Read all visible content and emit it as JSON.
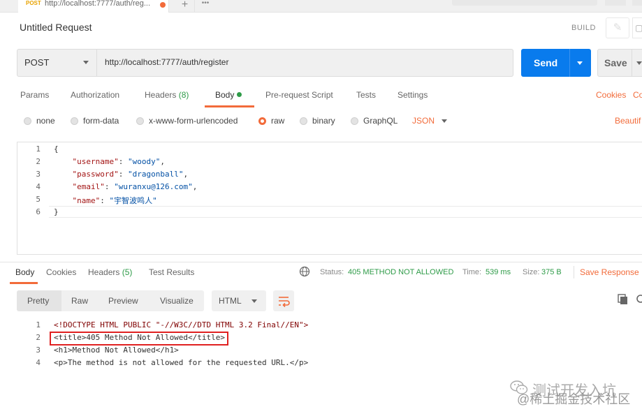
{
  "tab": {
    "method": "POST",
    "url": "http://localhost:7777/auth/reg..."
  },
  "header": {
    "title": "Untitled Request",
    "build": "BUILD"
  },
  "request": {
    "method": "POST",
    "url": "http://localhost:7777/auth/register",
    "send": "Send",
    "save": "Save"
  },
  "req_tabs": {
    "params": "Params",
    "authorization": "Authorization",
    "headers": "Headers",
    "headers_count": "(8)",
    "body": "Body",
    "prerequest": "Pre-request Script",
    "tests": "Tests",
    "settings": "Settings",
    "cookies": "Cookies",
    "code": "Co"
  },
  "body_types": {
    "none": "none",
    "form_data": "form-data",
    "urlencoded": "x-www-form-urlencoded",
    "raw": "raw",
    "binary": "binary",
    "graphql": "GraphQL",
    "format": "JSON",
    "beautify": "Beautif"
  },
  "editor": {
    "line_numbers": [
      "1",
      "2",
      "3",
      "4",
      "5",
      "6"
    ],
    "open": "{",
    "close": "}",
    "fields": [
      {
        "key": "\"username\"",
        "value": "\"woody\"",
        "comma": ","
      },
      {
        "key": "\"password\"",
        "value": "\"dragonball\"",
        "comma": ","
      },
      {
        "key": "\"email\"",
        "value": "\"wuranxu@126.com\"",
        "comma": ","
      },
      {
        "key": "\"name\"",
        "value": "\"宇智波鸣人\"",
        "comma": ""
      }
    ]
  },
  "response": {
    "tabs": {
      "body": "Body",
      "cookies": "Cookies",
      "headers": "Headers",
      "headers_count": "(5)",
      "test_results": "Test Results"
    },
    "status_label": "Status:",
    "status_value": "405 METHOD NOT ALLOWED",
    "time_label": "Time:",
    "time_value": "539 ms",
    "size_label": "Size:",
    "size_value": "375 B",
    "save_response": "Save Response",
    "views": {
      "pretty": "Pretty",
      "raw": "Raw",
      "preview": "Preview",
      "visualize": "Visualize"
    },
    "format": "HTML",
    "line_numbers": [
      "1",
      "2",
      "3",
      "4"
    ],
    "lines": [
      "<!DOCTYPE HTML PUBLIC \"-//W3C//DTD HTML 3.2 Final//EN\">",
      "<title>405 Method Not Allowed</title>",
      "<h1>Method Not Allowed</h1>",
      "<p>The method is not allowed for the requested URL.</p>"
    ]
  },
  "watermark": {
    "line1": "测试开发入坑",
    "line2": "@稀土掘金技术社区"
  },
  "colors": {
    "accent": "#f26b3a",
    "send": "#097bed",
    "status_ok": "#2e9b48",
    "highlight": "#e02020"
  },
  "icons": [
    "close-dot-icon",
    "plus-icon",
    "more-icon",
    "edit-icon",
    "caret-down-icon",
    "globe-icon",
    "wrap-lines-icon",
    "copy-icon",
    "search-icon",
    "wechat-icon"
  ]
}
